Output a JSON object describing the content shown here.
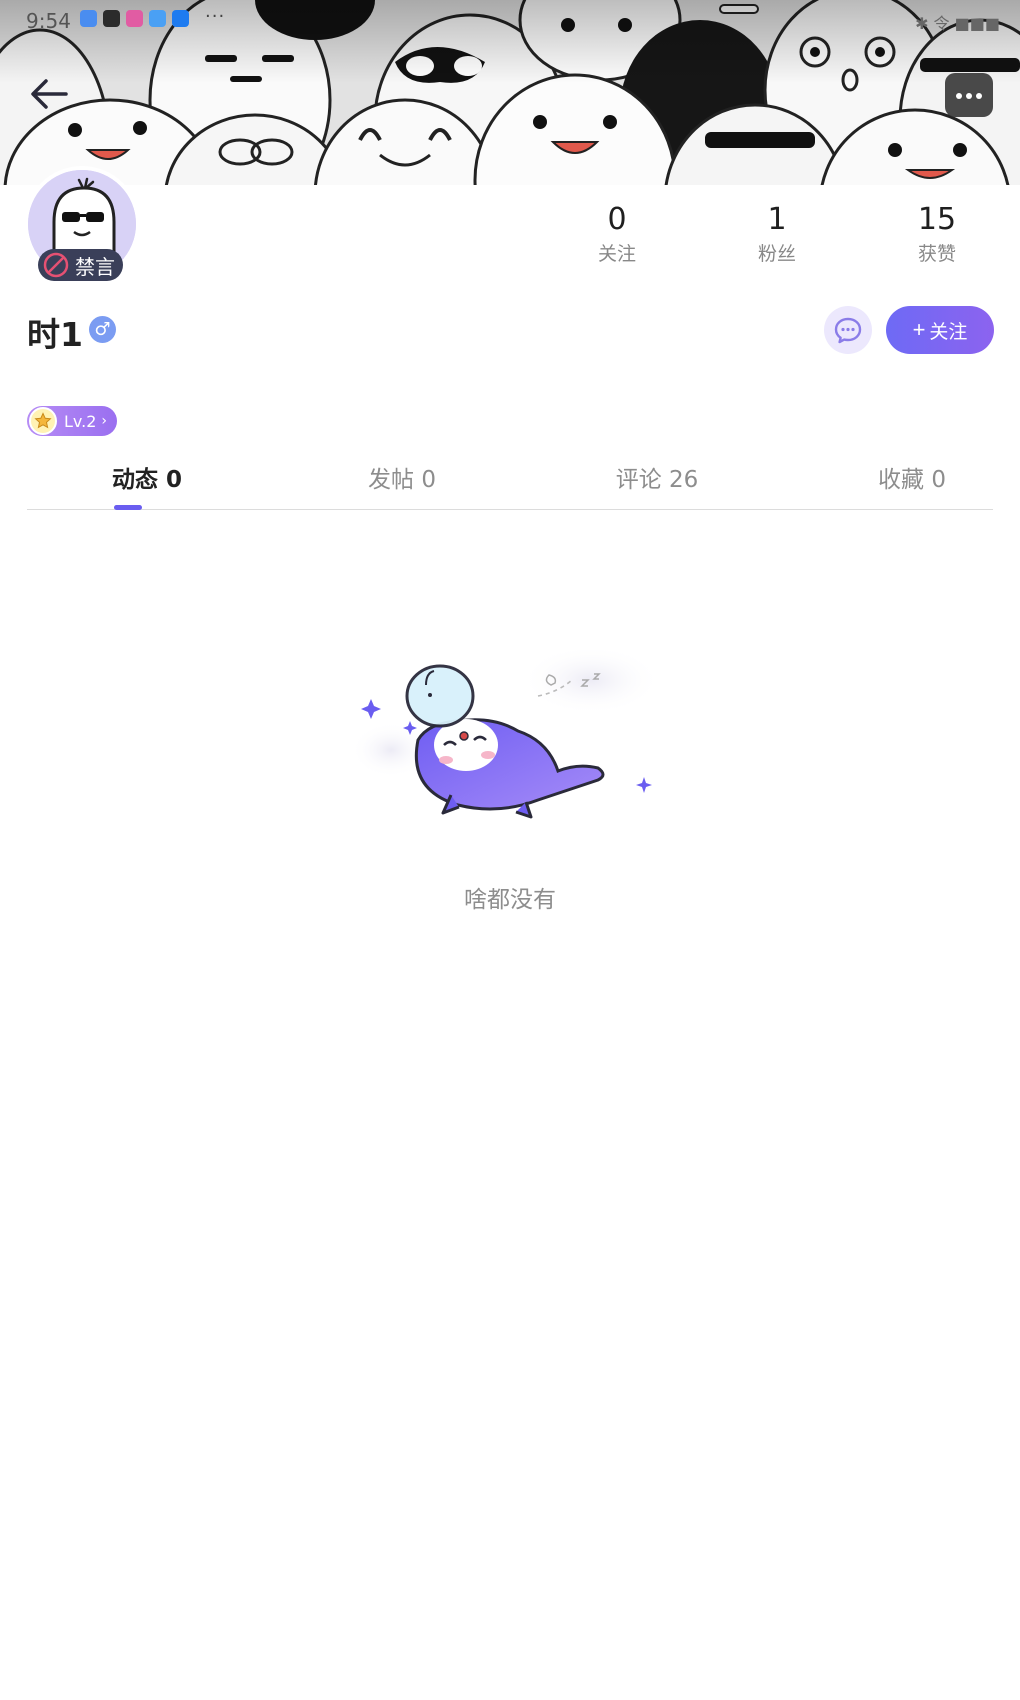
{
  "status_bar": {
    "time": "9:54",
    "more": "···",
    "right_text": "✱ 令 ■■■"
  },
  "icons": {
    "back": "arrow-left-icon",
    "more": "more-dots-icon",
    "message": "chat-bubble-icon",
    "gender": "male-icon",
    "mute": "ban-icon",
    "level_medal": "star-medal-icon"
  },
  "profile": {
    "mute_label": "禁言",
    "username": "时1",
    "gender_symbol": "♂",
    "level": "Lv.2"
  },
  "stats": [
    {
      "value": "0",
      "label": "关注"
    },
    {
      "value": "1",
      "label": "粉丝"
    },
    {
      "value": "15",
      "label": "获赞"
    }
  ],
  "actions": {
    "follow_plus": "+",
    "follow_label": "关注"
  },
  "tabs": [
    {
      "label": "动态 0",
      "active": true
    },
    {
      "label": "发帖 0",
      "active": false
    },
    {
      "label": "评论 26",
      "active": false
    },
    {
      "label": "收藏 0",
      "active": false
    }
  ],
  "empty_state": {
    "text": "啥都没有"
  },
  "colors": {
    "accent": "#6a5df0",
    "follow_gradient_start": "#6e6af5",
    "follow_gradient_end": "#8c63ef",
    "mute_badge": "#3a3f59",
    "level_badge": "#a77df2",
    "gender": "#7b9cf2"
  }
}
